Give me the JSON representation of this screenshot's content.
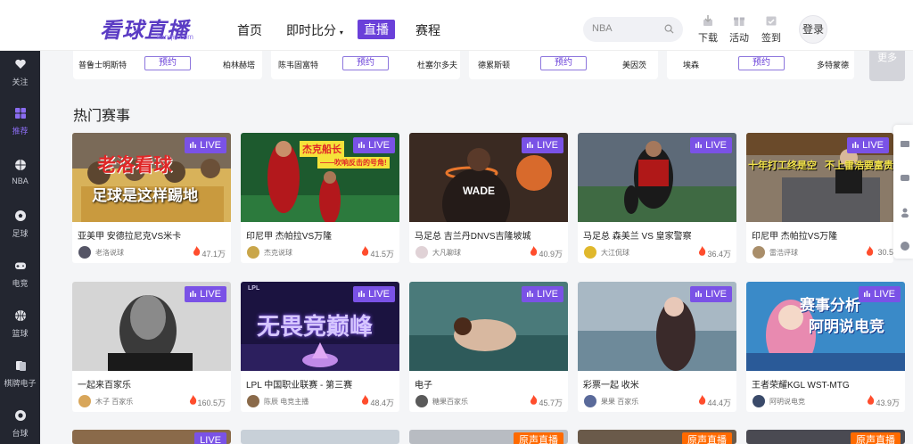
{
  "logo": {
    "text": "看球直播",
    "sub": "kanqiu.com"
  },
  "nav": {
    "home": "首页",
    "scores": "即时比分",
    "live": "直播",
    "schedule": "赛程"
  },
  "search": {
    "placeholder": "NBA"
  },
  "tools": {
    "download": "下载",
    "activity": "活动",
    "signin": "签到",
    "login": "登录"
  },
  "sidebar": [
    {
      "label": "关注",
      "icon": "heart-icon"
    },
    {
      "label": "推荐",
      "icon": "grid-icon",
      "active": true
    },
    {
      "label": "NBA",
      "icon": "basketball-icon"
    },
    {
      "label": "足球",
      "icon": "soccer-ball-icon"
    },
    {
      "label": "电竞",
      "icon": "gamepad-icon"
    },
    {
      "label": "篮球",
      "icon": "basketball-icon"
    },
    {
      "label": "棋牌电子",
      "icon": "cards-icon"
    },
    {
      "label": "台球",
      "icon": "billiards-icon"
    }
  ],
  "schedule": [
    {
      "home": "普鲁士明斯特",
      "away": "柏林赫塔",
      "action": "预约"
    },
    {
      "home": "陈韦固富特",
      "away": "杜塞尔多夫",
      "action": "预约"
    },
    {
      "home": "德累斯顿",
      "away": "美因茨",
      "action": "预约"
    },
    {
      "home": "埃森",
      "away": "多特蒙德",
      "action": "预约"
    }
  ],
  "schedule_more": "更多",
  "section_title": "热门赛事",
  "cards": [
    {
      "title": "亚美甲 安德拉尼克VS米卡",
      "host": "老洛说球",
      "heat": "47.1万",
      "badge": "LIVE",
      "overlay1": "老洛看球",
      "overlay2": "足球是这样踢地"
    },
    {
      "title": "印尼甲 杰帕拉VS万隆",
      "host": "杰克说球",
      "heat": "41.5万",
      "badge": "LIVE",
      "overlay1": "杰克船长",
      "overlay2": "——吹响反击的号角!"
    },
    {
      "title": "马足总 吉兰丹DNVS吉隆坡城",
      "host": "大凡聊球",
      "heat": "40.9万",
      "badge": "LIVE",
      "overlay1": "WADE"
    },
    {
      "title": "马足总 森美兰 VS 皇家警察",
      "host": "大江侃球",
      "heat": "36.4万",
      "badge": "LIVE"
    },
    {
      "title": "印尼甲 杰帕拉VS万隆",
      "host": "雷浩评球",
      "heat": "30.5",
      "badge": "LIVE",
      "overlay1": "十年打工终是空",
      "overlay2": "不上雷浩要富贵"
    },
    {
      "title": "一起来百家乐",
      "host": "木子 百家乐",
      "heat": "160.5万",
      "badge": "LIVE"
    },
    {
      "title": "LPL 中国职业联赛 - 第三赛",
      "host": "陈辰 电竞主播",
      "heat": "48.4万",
      "badge": "LIVE",
      "overlay1": "无畏竞巅峰",
      "overlay2": "LPL"
    },
    {
      "title": "电子",
      "host": "糖果百家乐",
      "heat": "45.7万",
      "badge": "LIVE"
    },
    {
      "title": "彩票一起 收米",
      "host": "果果 百家乐",
      "heat": "44.4万",
      "badge": "LIVE"
    },
    {
      "title": "王者荣耀KGL WST-MTG",
      "host": "阿明说电竞",
      "heat": "43.9万",
      "badge": "LIVE",
      "overlay1": "赛事分析",
      "overlay2": "阿明说电竞"
    }
  ],
  "bottom_badges": [
    "LIVE",
    "",
    "原声直播",
    "原声直播",
    "原声直播"
  ],
  "colors": {
    "accent": "#6a40d9",
    "live_badge": "#7a52e6",
    "sidebar": "#232630",
    "heat": "#ff4d2d"
  }
}
